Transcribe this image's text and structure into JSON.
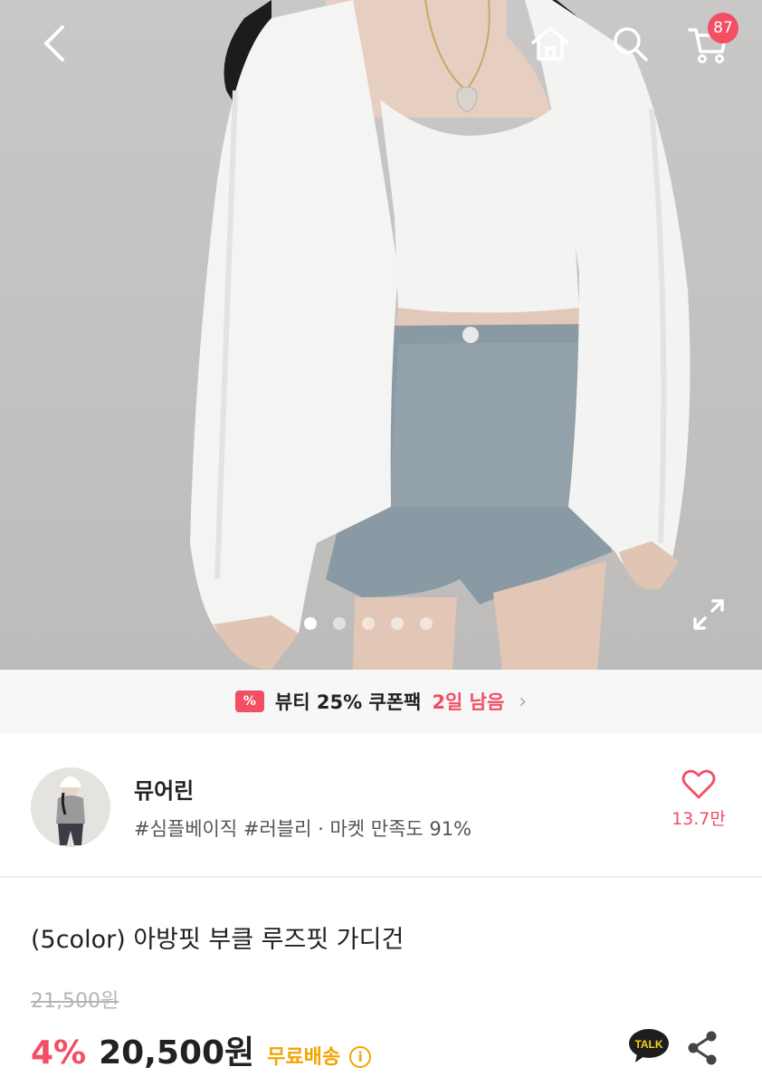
{
  "header": {
    "back_icon": "chevron-left-icon",
    "home_icon": "home-icon",
    "search_icon": "search-icon",
    "cart_icon": "cart-icon",
    "cart_count": "87"
  },
  "gallery": {
    "image_count": 5,
    "active_index": 0,
    "expand_icon": "expand-icon"
  },
  "coupon": {
    "icon_text": "%",
    "text": "뷰티 25% 쿠폰팩",
    "highlight": "2일 남음",
    "arrow": "›"
  },
  "shop": {
    "name": "뮤어린",
    "tags": "#심플베이직 #러블리 · 마켓 만족도 91%",
    "like_count": "13.7만"
  },
  "product": {
    "title": "(5color) 아방핏 부클 루즈핏 가디건",
    "original_price": "21,500원",
    "discount": "4%",
    "price": "20,500원",
    "free_shipping": "무료배송",
    "info_icon": "i",
    "talk_label": "TALK"
  },
  "colors": {
    "accent": "#f24e64",
    "shipping": "#f2a500"
  }
}
